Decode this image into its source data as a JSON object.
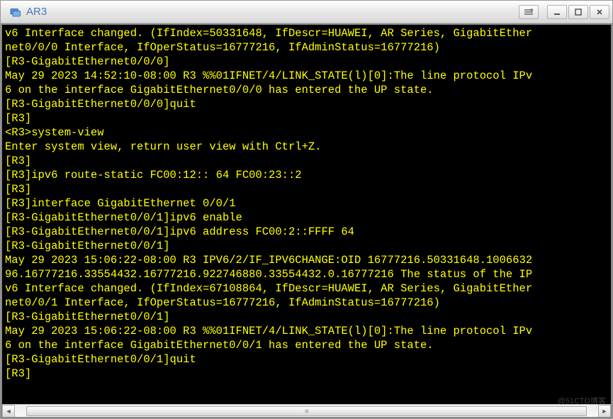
{
  "window": {
    "title": "AR3"
  },
  "terminal": {
    "lines": [
      "v6 Interface changed. (IfIndex=50331648, IfDescr=HUAWEI, AR Series, GigabitEther",
      "net0/0/0 Interface, IfOperStatus=16777216, IfAdminStatus=16777216)",
      "[R3-GigabitEthernet0/0/0]",
      "May 29 2023 14:52:10-08:00 R3 %%01IFNET/4/LINK_STATE(l)[0]:The line protocol IPv",
      "6 on the interface GigabitEthernet0/0/0 has entered the UP state.",
      "[R3-GigabitEthernet0/0/0]quit",
      "[R3]",
      "<R3>system-view",
      "Enter system view, return user view with Ctrl+Z.",
      "[R3]",
      "[R3]ipv6 route-static FC00:12:: 64 FC00:23::2",
      "[R3]",
      "[R3]interface GigabitEthernet 0/0/1",
      "[R3-GigabitEthernet0/0/1]ipv6 enable",
      "[R3-GigabitEthernet0/0/1]ipv6 address FC00:2::FFFF 64",
      "[R3-GigabitEthernet0/0/1]",
      "May 29 2023 15:06:22-08:00 R3 IPV6/2/IF_IPV6CHANGE:OID 16777216.50331648.1006632",
      "96.16777216.33554432.16777216.922746880.33554432.0.16777216 The status of the IP",
      "v6 Interface changed. (IfIndex=67108864, IfDescr=HUAWEI, AR Series, GigabitEther",
      "net0/0/1 Interface, IfOperStatus=16777216, IfAdminStatus=16777216)",
      "[R3-GigabitEthernet0/0/1]",
      "May 29 2023 15:06:22-08:00 R3 %%01IFNET/4/LINK_STATE(l)[0]:The line protocol IPv",
      "6 on the interface GigabitEthernet0/0/1 has entered the UP state.",
      "[R3-GigabitEthernet0/0/1]quit",
      "[R3]"
    ]
  },
  "watermark": "@51CTO博客"
}
